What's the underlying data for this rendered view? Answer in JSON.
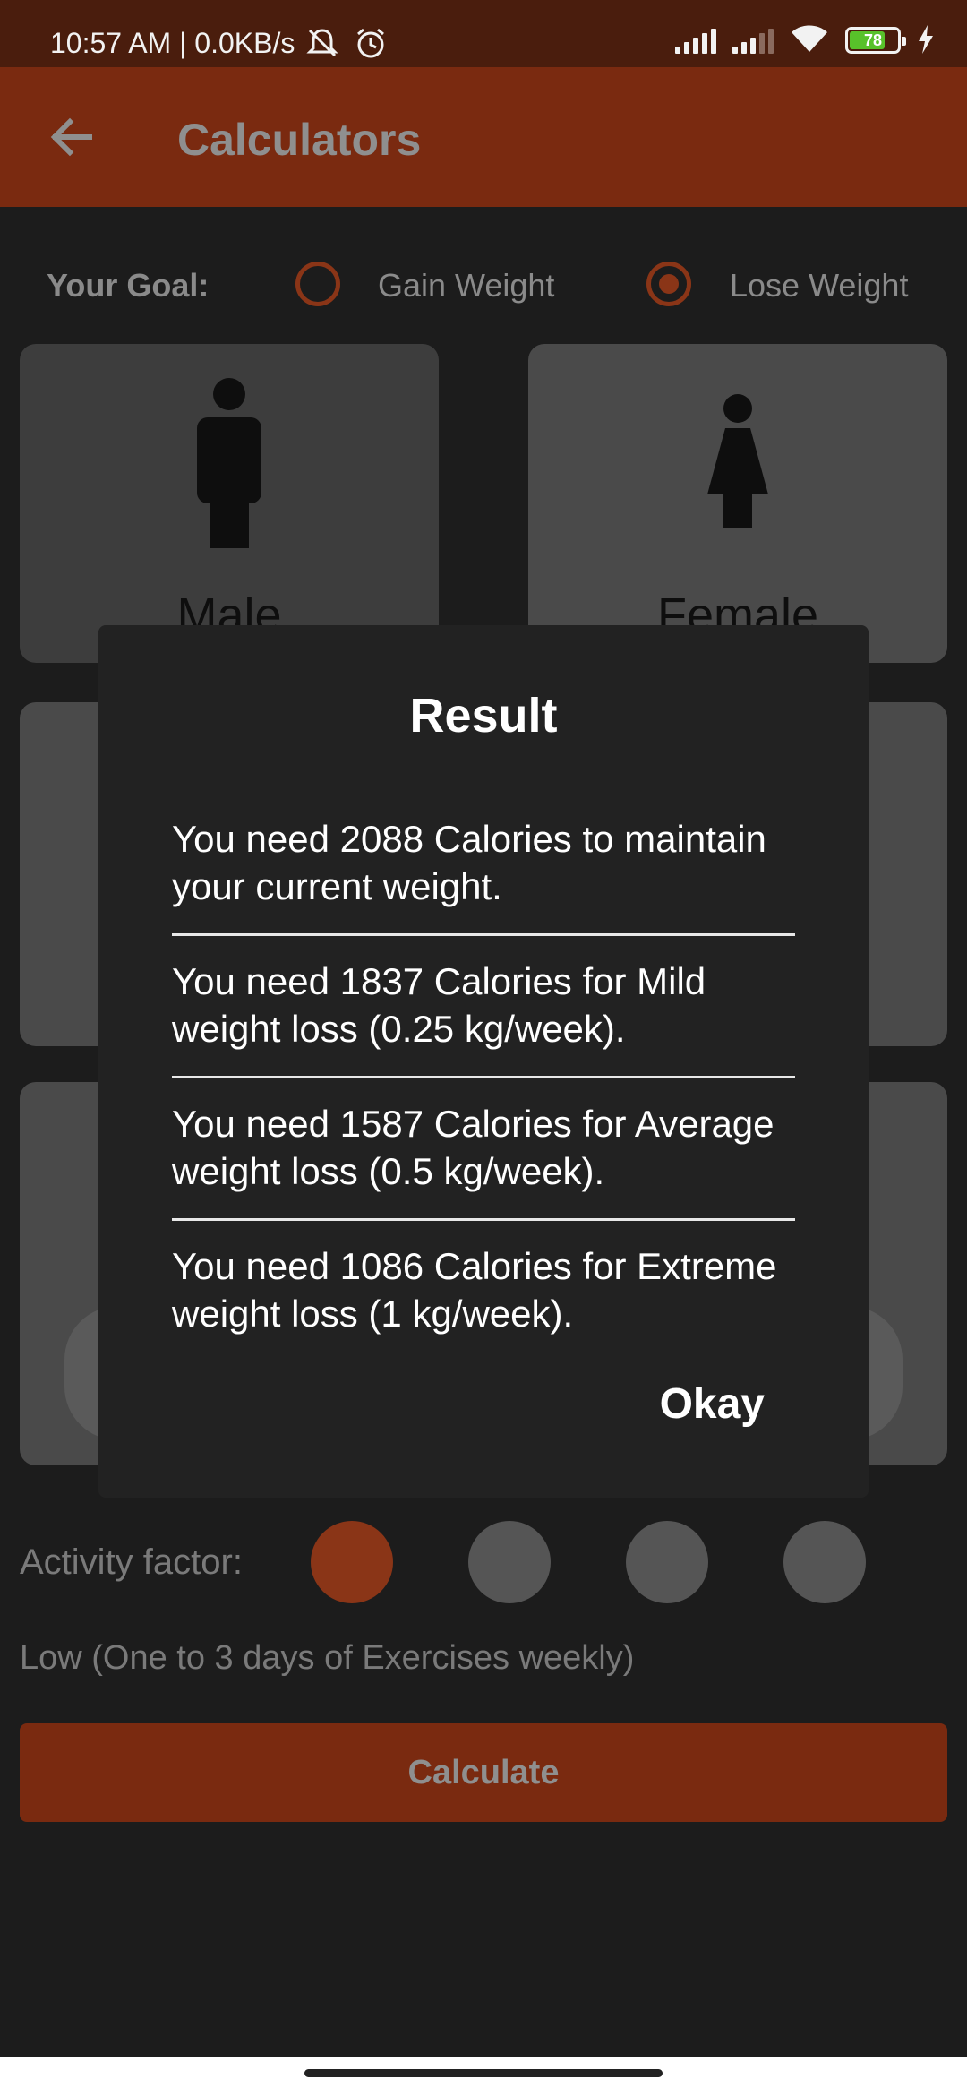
{
  "status_bar": {
    "time_text": "10:57 AM | 0.0KB/s",
    "battery_level": "78"
  },
  "app_bar": {
    "title": "Calculators"
  },
  "goal": {
    "label": "Your Goal:",
    "options": [
      {
        "label": "Gain Weight",
        "selected": false
      },
      {
        "label": "Lose Weight",
        "selected": true
      }
    ]
  },
  "gender_cards": [
    {
      "label": "Male"
    },
    {
      "label": "Female"
    }
  ],
  "activity": {
    "label": "Activity factor:",
    "selected_index": 0,
    "description": "Low (One to 3 days of Exercises weekly)"
  },
  "calculate_label": "Calculate",
  "dialog": {
    "title": "Result",
    "results": [
      "You need 2088 Calories to maintain your current weight.",
      "You need 1837 Calories for Mild weight loss (0.25 kg/week).",
      "You need 1587 Calories for Average weight loss (0.5 kg/week).",
      "You need 1086 Calories for Extreme weight loss (1 kg/week)."
    ],
    "okay_label": "Okay"
  },
  "colors": {
    "accent": "#7a2a10",
    "status_bar": "#4a1d0d",
    "dialog_bg": "#222222"
  }
}
